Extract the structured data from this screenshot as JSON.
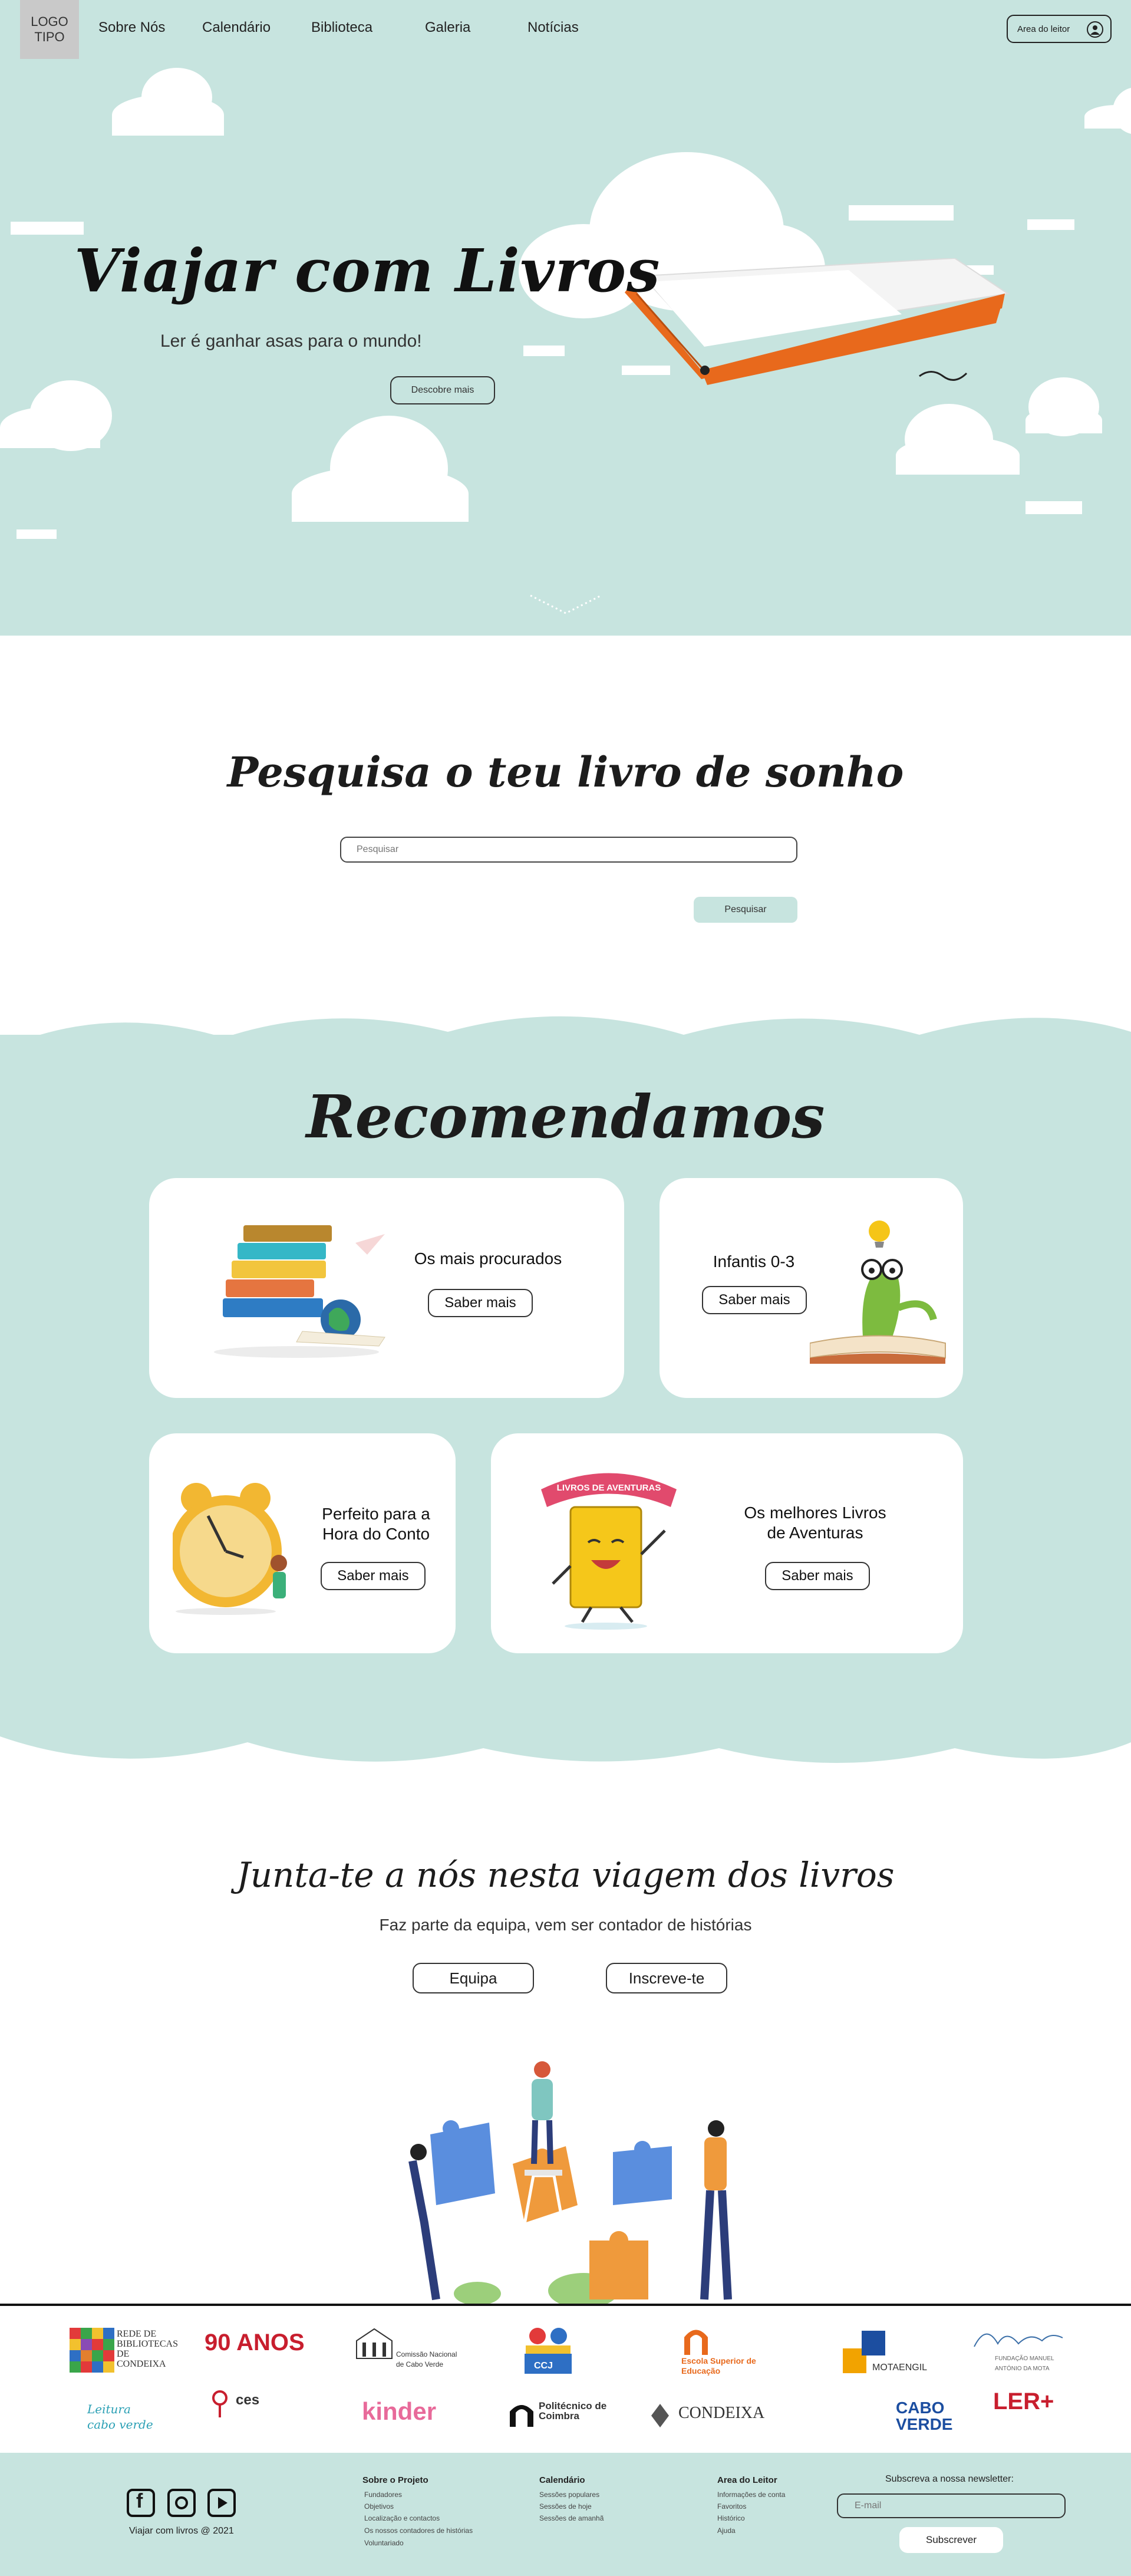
{
  "nav": {
    "logo": "LOGO TIPO",
    "links": [
      "Sobre Nós",
      "Calendário",
      "Biblioteca",
      "Galeria",
      "Notícias"
    ],
    "reader_area": "Area do leitor"
  },
  "hero": {
    "title": "Viajar com Livros",
    "subtitle": "Ler é ganhar asas para o mundo!",
    "button": "Descobre mais"
  },
  "search": {
    "title": "Pesquisa o teu livro de sonho",
    "placeholder": "Pesquisar",
    "button": "Pesquisar"
  },
  "recommend": {
    "title": "Recomendamos",
    "cards": [
      {
        "label": "Os mais procurados",
        "button": "Saber mais"
      },
      {
        "label": "Infantis 0-3",
        "button": "Saber mais"
      },
      {
        "label": "Perfeito para a Hora do Conto",
        "button": "Saber mais"
      },
      {
        "label": "Os melhores Livros de Aventuras",
        "button": "Saber mais",
        "banner": "LIVROS DE AVENTURAS"
      }
    ]
  },
  "join": {
    "title": "Junta-te a nós nesta viagem dos livros",
    "subtitle": "Faz parte da equipa, vem ser contador de histórias",
    "buttons": [
      "Equipa",
      "Inscreve-te"
    ]
  },
  "partners": [
    "REDE DE BIBLIOTECAS DE CONDEIXA",
    "90 ANOS",
    "Comissão Nacional de Cabo Verde",
    "CCJ",
    "Escola Superior de Educação",
    "MOTAENGIL",
    "FUNDAÇÃO MANUEL ANTÓNIO DA MOTA",
    "Leitura cabo verde",
    "ces",
    "kinder",
    "Politécnico de Coimbra",
    "CONDEIXA",
    "CABO VERDE",
    "LER+"
  ],
  "footer": {
    "copyright": "Viajar com livros @ 2021",
    "columns": [
      {
        "title": "Sobre o Projeto",
        "links": [
          "Fundadores",
          "Objetivos",
          "Localização e contactos",
          "Os nossos contadores de histórias",
          "Voluntariado"
        ]
      },
      {
        "title": "Calendário",
        "links": [
          "Sessões populares",
          "Sessões de hoje",
          "Sessões de amanhã"
        ]
      },
      {
        "title": "Area do Leitor",
        "links": [
          "Informações de conta",
          "Favoritos",
          "Histórico",
          "Ajuda"
        ]
      }
    ],
    "newsletter": {
      "label": "Subscreva a nossa newsletter:",
      "placeholder": "E-mail",
      "button": "Subscrever"
    }
  },
  "colors": {
    "mint": "#c7e4df",
    "book_orange": "#e8691c"
  }
}
